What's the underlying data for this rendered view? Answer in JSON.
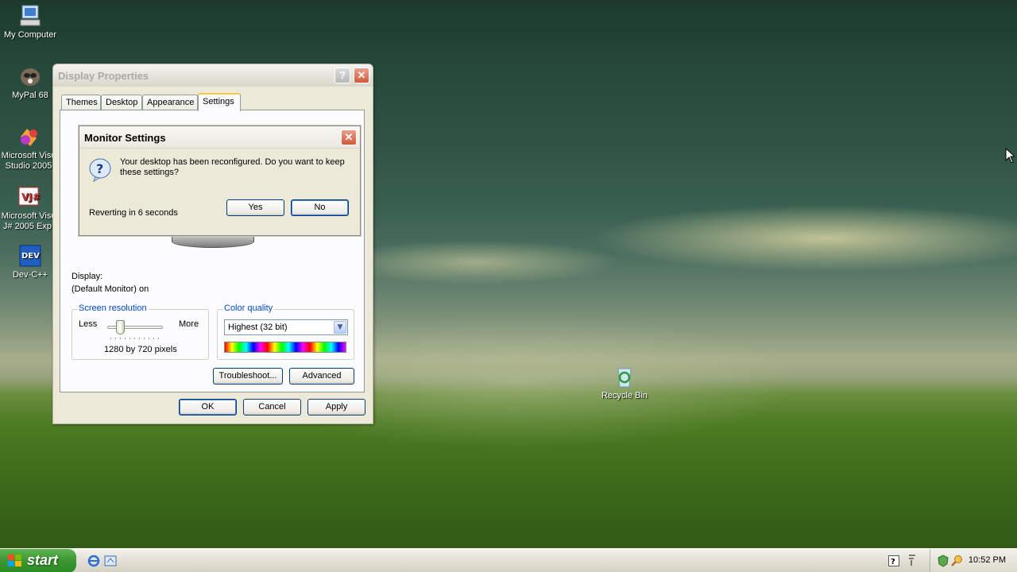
{
  "desktop": {
    "icons": [
      {
        "label": "My Computer"
      },
      {
        "label": "MyPal 68"
      },
      {
        "label_line1": "Microsoft Visu",
        "label_line2": "Studio 2005"
      },
      {
        "label_line1": "Microsoft Visu",
        "label_line2": "J# 2005 Exp."
      },
      {
        "label": "Dev-C++"
      },
      {
        "label": "Recycle Bin"
      }
    ]
  },
  "display_properties": {
    "title": "Display Properties",
    "help_glyph": "?",
    "close_glyph": "✕",
    "tabs": [
      {
        "label": "Themes"
      },
      {
        "label": "Desktop"
      },
      {
        "label": "Appearance"
      },
      {
        "label": "Settings",
        "active": true
      }
    ],
    "display_label": "Display:",
    "display_value": "(Default Monitor) on",
    "screen_resolution": {
      "legend": "Screen resolution",
      "less": "Less",
      "more": "More",
      "value": "1280 by 720 pixels"
    },
    "color_quality": {
      "legend": "Color quality",
      "selected": "Highest (32 bit)"
    },
    "buttons": {
      "troubleshoot": "Troubleshoot...",
      "advanced": "Advanced",
      "ok": "OK",
      "cancel": "Cancel",
      "apply": "Apply"
    }
  },
  "monitor_settings": {
    "title": "Monitor Settings",
    "message_line1": "Your desktop has been reconfigured.  Do you want to keep",
    "message_line2": "these settings?",
    "countdown": "Reverting in 6 seconds",
    "yes": "Yes",
    "no": "No"
  },
  "taskbar": {
    "start_label": "start",
    "clock": "10:52 PM"
  },
  "colors": {
    "accent_blue": "#0046d5",
    "start_green": "#3d9934",
    "close_red": "#d0593b"
  }
}
